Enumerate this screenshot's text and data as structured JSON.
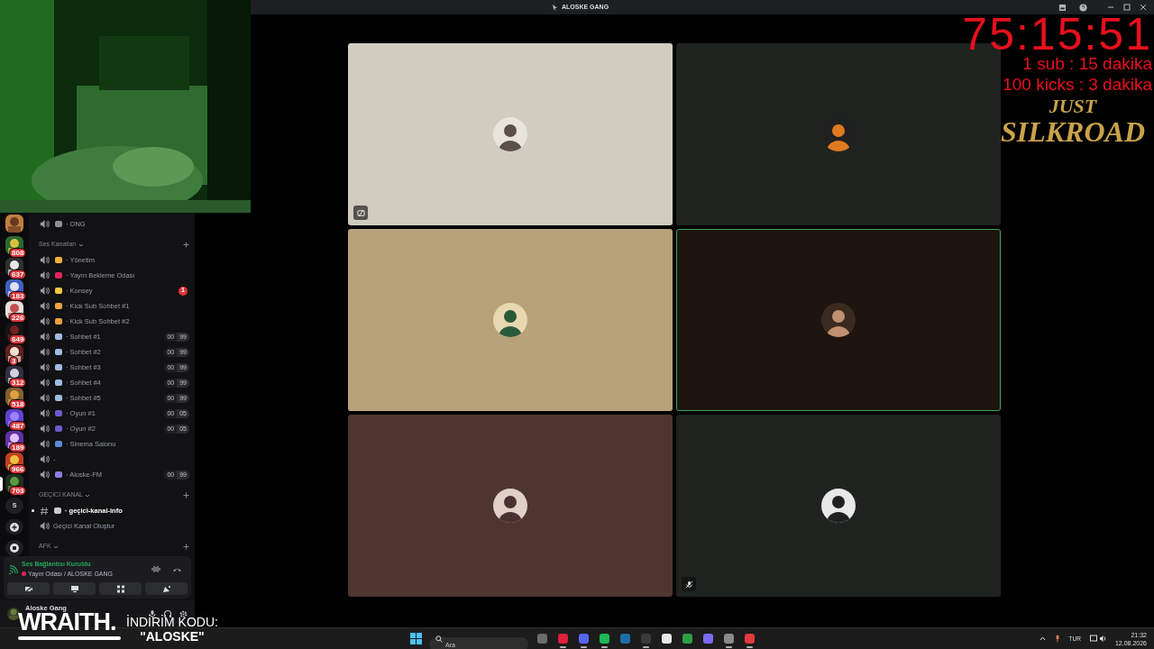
{
  "title_bar": {
    "title": "ALOSKE GANG"
  },
  "timer_overlay": {
    "timer": "75:15:51",
    "lines": [
      "1 sub : 15 dakika",
      "100 kicks : 3 dakika"
    ],
    "logo": [
      "JUST",
      "SILKROAD"
    ]
  },
  "servers": [
    {
      "selected": false
    },
    {
      "badge": "808",
      "selected": false
    },
    {
      "badge": "637",
      "selected": false
    },
    {
      "badge": "183",
      "selected": false
    },
    {
      "badge": "226",
      "selected": false
    },
    {
      "badge": "649",
      "selected": false
    },
    {
      "badge": "3",
      "selected": false
    },
    {
      "badge": "312",
      "selected": false
    },
    {
      "badge": "518",
      "selected": false
    },
    {
      "badge": "487",
      "selected": false
    },
    {
      "badge": "189",
      "selected": false
    },
    {
      "badge": "966",
      "selected": false
    },
    {
      "badge": "703",
      "selected": true
    }
  ],
  "server_actions": [
    {
      "kind": "letter",
      "label": "S"
    },
    {
      "kind": "add"
    },
    {
      "kind": "discover"
    }
  ],
  "channels": [
    {
      "kind": "voice",
      "name": "· ONG",
      "color": "#8a8d93"
    },
    {
      "kind": "category",
      "name": "Ses Kanalları"
    },
    {
      "kind": "voice",
      "name": "· Yönetim",
      "color": "#f0b232"
    },
    {
      "kind": "voice",
      "name": "· Yayın Bekleme Odası",
      "color": "#e0245e"
    },
    {
      "kind": "voice",
      "name": "· Konsey",
      "color": "#f5c542",
      "badge": "1"
    },
    {
      "kind": "voice",
      "name": "· Kick Sub Sohbet #1",
      "color": "#f0a040"
    },
    {
      "kind": "voice",
      "name": "· Kick Sub Sohbet #2",
      "color": "#f0a040"
    },
    {
      "kind": "voice",
      "name": "· Sohbet #1",
      "color": "#9fbce0",
      "limit": [
        "00",
        "99"
      ]
    },
    {
      "kind": "voice",
      "name": "· Sohbet #2",
      "color": "#9fbce0",
      "limit": [
        "00",
        "99"
      ]
    },
    {
      "kind": "voice",
      "name": "· Sohbet #3",
      "color": "#9fbce0",
      "limit": [
        "00",
        "99"
      ]
    },
    {
      "kind": "voice",
      "name": "· Sohbet #4",
      "color": "#9fbce0",
      "limit": [
        "00",
        "99"
      ]
    },
    {
      "kind": "voice",
      "name": "· Sohbet #5",
      "color": "#9fbce0",
      "limit": [
        "00",
        "99"
      ]
    },
    {
      "kind": "voice",
      "name": "· Oyun #1",
      "color": "#6a5acd",
      "limit": [
        "00",
        "05"
      ]
    },
    {
      "kind": "voice",
      "name": "· Oyun #2",
      "color": "#6a5acd",
      "limit": [
        "00",
        "05"
      ]
    },
    {
      "kind": "voice",
      "name": "· Sinema Salonu",
      "color": "#5b8dd6"
    },
    {
      "kind": "plain",
      "name": "-"
    },
    {
      "kind": "voice",
      "name": "· Aloske-FM",
      "color": "#8f7ce0",
      "limit": [
        "00",
        "99"
      ]
    },
    {
      "kind": "category",
      "name": "GEÇİCİ KANAL"
    },
    {
      "kind": "text",
      "name": "· geçici-kanal-info",
      "color": "#c8cbd0",
      "unread": true
    },
    {
      "kind": "plain",
      "name": "Geçici Kanal Oluştur"
    },
    {
      "kind": "category",
      "name": "AFK"
    }
  ],
  "voice_panel": {
    "status": "Ses Bağlantısı Kuruldu",
    "channel": "Yayın Odası / ALOSKE GANG"
  },
  "user_panel": {
    "name": "Aloske Gang"
  },
  "tiles": [
    {
      "color": "#d0ccc0",
      "speaking": false,
      "video_off": true,
      "muted": false
    },
    {
      "color": "#1f231f",
      "speaking": false,
      "video_off": false,
      "muted": false
    },
    {
      "color": "#b8a27a",
      "speaking": false,
      "video_off": false,
      "muted": false
    },
    {
      "color": "#1e1510",
      "speaking": true,
      "video_off": false,
      "muted": false
    },
    {
      "color": "#4f3530",
      "speaking": false,
      "video_off": false,
      "muted": false
    },
    {
      "color": "#1f231f",
      "speaking": false,
      "video_off": false,
      "muted": true
    }
  ],
  "sponsor_overlay": {
    "brand": "WRAITH.",
    "code_label": "İNDİRİM KODU:",
    "code": "\"ALOSKE\""
  },
  "taskbar": {
    "search_placeholder": "Ara",
    "apps": [
      {
        "color": "#6b6b6b",
        "running": false
      },
      {
        "color": "#e0213a",
        "running": true
      },
      {
        "color": "#5865f2",
        "running": true
      },
      {
        "color": "#1db954",
        "running": true
      },
      {
        "color": "#1b6fa8",
        "running": false
      },
      {
        "color": "#3a3a3a",
        "running": true
      },
      {
        "color": "#e8e8e8",
        "running": false
      },
      {
        "color": "#2ea043",
        "running": false
      },
      {
        "color": "#7a6cf0",
        "running": false
      },
      {
        "color": "#8a8a8a",
        "running": true
      },
      {
        "color": "#e03a3e",
        "running": true
      }
    ],
    "language": "TUR",
    "time": "21:32",
    "date": "12.08.2026"
  }
}
